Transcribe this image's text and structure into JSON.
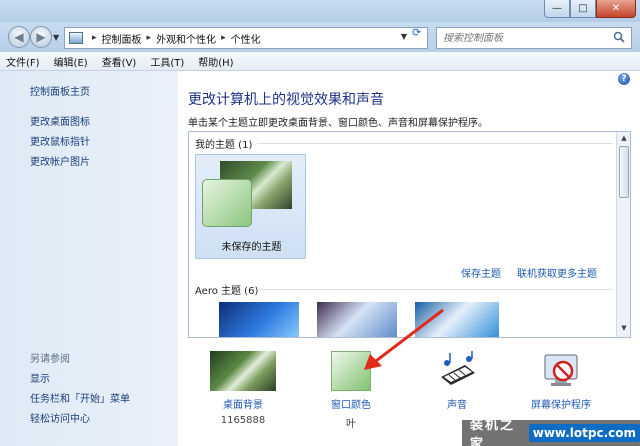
{
  "window": {
    "controls": {
      "min": "—",
      "max": "□",
      "close": "✕"
    }
  },
  "address": {
    "crumbs": [
      "控制面板",
      "外观和个性化",
      "个性化"
    ],
    "search_placeholder": "搜索控制面板"
  },
  "menu": [
    "文件(F)",
    "编辑(E)",
    "查看(V)",
    "工具(T)",
    "帮助(H)"
  ],
  "sidebar": {
    "home": "控制面板主页",
    "links": [
      "更改桌面图标",
      "更改鼠标指针",
      "更改帐户图片"
    ],
    "see_also_title": "另请参阅",
    "see_also": [
      "显示",
      "任务栏和「开始」菜单",
      "轻松访问中心"
    ]
  },
  "main": {
    "heading": "更改计算机上的视觉效果和声音",
    "subheading": "单击某个主题立即更改桌面背景、窗口颜色、声音和屏幕保护程序。",
    "my_themes_label": "我的主题 (1)",
    "unsaved_theme": "未保存的主题",
    "save_theme": "保存主题",
    "get_more_themes": "联机获取更多主题",
    "aero_label": "Aero 主题 (6)"
  },
  "bottom": [
    {
      "label": "桌面背景",
      "sub": "1165888"
    },
    {
      "label": "窗口颜色",
      "sub": "叶"
    },
    {
      "label": "声音",
      "sub": ""
    },
    {
      "label": "屏幕保护程序",
      "sub": ""
    }
  ],
  "watermark": {
    "cn": "装机之家",
    "en": "www.lotpc.com"
  },
  "colors": {
    "link": "#1c5ab4",
    "heading": "#1e3287",
    "arrow": "#e02a1a"
  }
}
